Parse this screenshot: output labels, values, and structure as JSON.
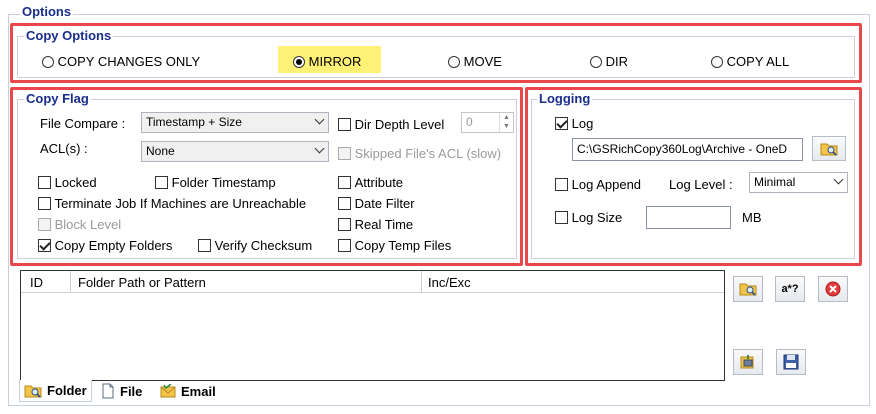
{
  "options": {
    "title": "Options"
  },
  "copy_options": {
    "title": "Copy Options",
    "choices": [
      {
        "label": "COPY CHANGES ONLY",
        "selected": false
      },
      {
        "label": "MIRROR",
        "selected": true,
        "highlight": "#fff176"
      },
      {
        "label": "MOVE",
        "selected": false
      },
      {
        "label": "DIR",
        "selected": false
      },
      {
        "label": "COPY ALL",
        "selected": false
      }
    ]
  },
  "copy_flag": {
    "title": "Copy Flag",
    "file_compare_label": "File Compare :",
    "file_compare_value": "Timestamp + Size",
    "acl_label": "ACL(s) :",
    "acl_value": "None",
    "dir_depth_label": "Dir Depth Level",
    "dir_depth_value": "0",
    "skipped_acl_label": "Skipped File's ACL (slow)",
    "locked": "Locked",
    "folder_timestamp": "Folder Timestamp",
    "attribute": "Attribute",
    "terminate_job": "Terminate Job If Machines are Unreachable",
    "date_filter": "Date Filter",
    "block_level": "Block Level",
    "real_time": "Real Time",
    "copy_empty_folders": "Copy Empty Folders",
    "verify_checksum": "Verify Checksum",
    "copy_temp_files": "Copy Temp Files"
  },
  "logging": {
    "title": "Logging",
    "log_label": "Log",
    "log_path": "C:\\GSRichCopy360Log\\Archive - OneD",
    "log_append_label": "Log Append",
    "log_level_label": "Log Level :",
    "log_level_value": "Minimal",
    "log_size_label": "Log Size",
    "log_size_value": "",
    "mb_label": "MB"
  },
  "grid": {
    "columns": [
      "ID",
      "Folder Path or Pattern",
      "Inc/Exc"
    ]
  },
  "side_buttons": {
    "regex_label": "a*?"
  },
  "tabs": [
    {
      "label": "Folder",
      "icon": "folder-search-icon"
    },
    {
      "label": "File",
      "icon": "file-icon"
    },
    {
      "label": "Email",
      "icon": "email-icon"
    }
  ],
  "colors": {
    "accent_title": "#1a2e8c",
    "highlight_box": "#e8474c",
    "selection_yellow": "#fff176"
  }
}
